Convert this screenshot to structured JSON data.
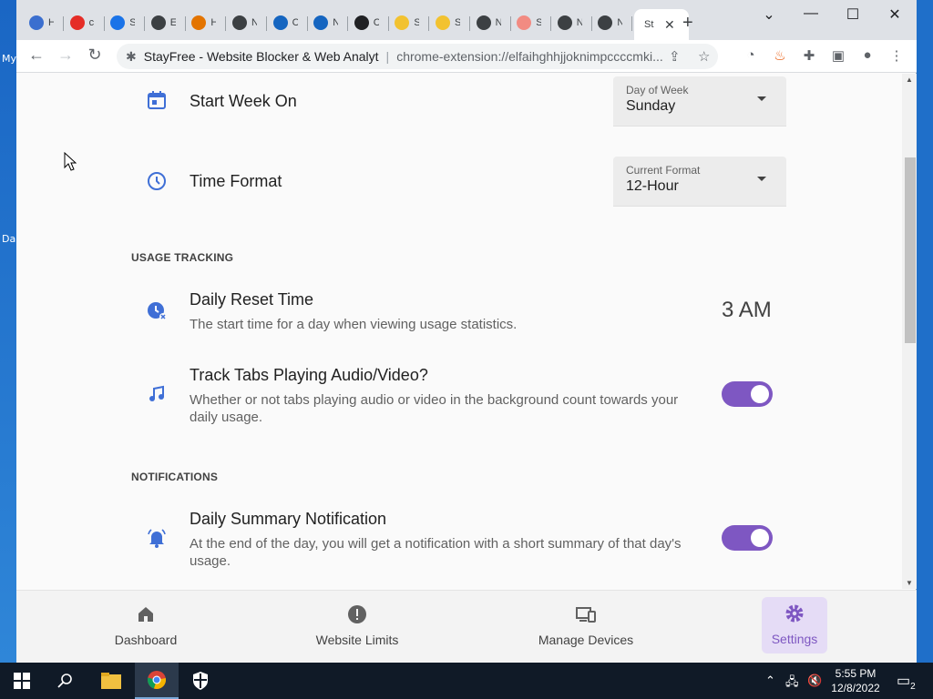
{
  "desktop": {
    "labels": [
      "My",
      "Da"
    ]
  },
  "browser": {
    "tabs": [
      {
        "label": "H",
        "color": "#3b6fcf"
      },
      {
        "label": "c",
        "color": "#e52d27"
      },
      {
        "label": "S",
        "color": "#1a73e8"
      },
      {
        "label": "E",
        "color": "#3c4043"
      },
      {
        "label": "H",
        "color": "#e37400"
      },
      {
        "label": "N",
        "color": "#3c4043"
      },
      {
        "label": "C",
        "color": "#1565c0"
      },
      {
        "label": "N",
        "color": "#1565c0"
      },
      {
        "label": "C",
        "color": "#202124"
      },
      {
        "label": "S",
        "color": "#f2c230"
      },
      {
        "label": "S",
        "color": "#f2c230"
      },
      {
        "label": "N",
        "color": "#3c4043"
      },
      {
        "label": "S",
        "color": "#f28b82"
      },
      {
        "label": "N",
        "color": "#3c4043"
      },
      {
        "label": "N",
        "color": "#3c4043"
      }
    ],
    "active_tab": {
      "label": "St",
      "close": "✕"
    },
    "new_tab": "+",
    "window_controls": {
      "minimize": "⌄",
      "restore": "—",
      "maximize": "☐",
      "close": "✕"
    },
    "site_name": "StayFree - Website Blocker & Web Analyt",
    "url": "chrome-extension://elfaihghhjjoknimpccccmki..."
  },
  "settings": {
    "start_week": {
      "title": "Start Week On",
      "select_label": "Day of Week",
      "select_value": "Sunday"
    },
    "time_format": {
      "title": "Time Format",
      "select_label": "Current Format",
      "select_value": "12-Hour"
    },
    "usage_section": "USAGE TRACKING",
    "daily_reset": {
      "title": "Daily Reset Time",
      "subtitle": "The start time for a day when viewing usage statistics.",
      "value": "3 AM"
    },
    "track_tabs": {
      "title": "Track Tabs Playing Audio/Video?",
      "subtitle": "Whether or not tabs playing audio or video in the background count towards your daily usage.",
      "enabled": true
    },
    "notifications_section": "NOTIFICATIONS",
    "daily_summary": {
      "title": "Daily Summary Notification",
      "subtitle": "At the end of the day, you will get a notification with a short summary of that day's usage.",
      "enabled": true
    }
  },
  "bottom_nav": {
    "items": [
      {
        "label": "Dashboard",
        "icon": "home-icon"
      },
      {
        "label": "Website Limits",
        "icon": "alert-icon"
      },
      {
        "label": "Manage Devices",
        "icon": "devices-icon"
      },
      {
        "label": "Settings",
        "icon": "gear-icon",
        "active": true
      }
    ]
  },
  "taskbar": {
    "time": "5:55 PM",
    "date": "12/8/2022",
    "notification_count": "2"
  },
  "colors": {
    "accent": "#7e57c2",
    "icon_blue": "#3f6fd6"
  }
}
